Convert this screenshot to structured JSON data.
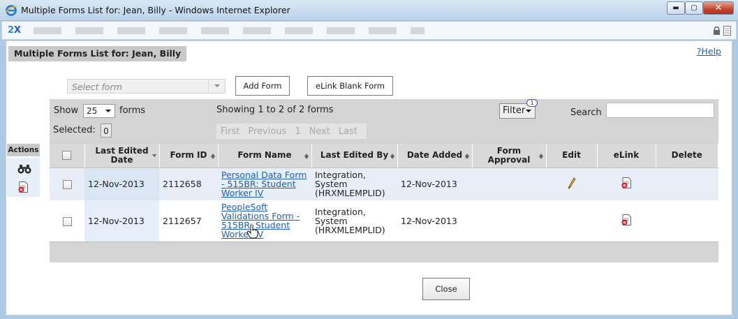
{
  "window": {
    "title": "Multiple Forms List for: Jean, Billy - Windows Internet Explorer",
    "minimize_glyph": "▬",
    "maximize_glyph": "▢",
    "close_glyph": "✕"
  },
  "toolbar": {
    "brand_a": "2",
    "brand_b": "X"
  },
  "page": {
    "title": "Multiple Forms List for: Jean, Billy",
    "help_label": "?Help"
  },
  "form_select": {
    "placeholder": "Select form"
  },
  "buttons": {
    "add_form": "Add Form",
    "elink_blank": "eLink Blank Form",
    "close": "Close"
  },
  "controls": {
    "show_label": "Show",
    "page_size": "25",
    "forms_label": "forms",
    "showing": "Showing 1 to 2 of 2 forms",
    "filter_label": "Filter",
    "filter_badge": "1",
    "search_label": "Search",
    "selected_label": "Selected:",
    "selected_count": "0"
  },
  "pager": {
    "first": "First",
    "previous": "Previous",
    "page": "1",
    "next": "Next",
    "last": "Last"
  },
  "actions": {
    "label": "Actions"
  },
  "table": {
    "columns": {
      "last_edited_date": "Last Edited Date",
      "form_id": "Form ID",
      "form_name": "Form Name",
      "last_edited_by": "Last Edited By",
      "date_added": "Date Added",
      "form_approval": "Form Approval",
      "edit": "Edit",
      "elink": "eLink",
      "delete": "Delete"
    },
    "rows": [
      {
        "last_edited_date": "12-Nov-2013",
        "form_id": "2112658",
        "form_name": "Personal Data Form - 515BR: Student Worker IV",
        "last_edited_by_1": "Integration,",
        "last_edited_by_2": "System",
        "last_edited_by_3": "(HRXMLEMPLID)",
        "date_added": "12-Nov-2013"
      },
      {
        "last_edited_date": "12-Nov-2013",
        "form_id": "2112657",
        "form_name": "PeopleSoft Validations Form - 515BR: Student Worker IV",
        "last_edited_by_1": "Integration,",
        "last_edited_by_2": "System",
        "last_edited_by_3": "(HRXMLEMPLID)",
        "date_added": "12-Nov-2013"
      }
    ]
  }
}
